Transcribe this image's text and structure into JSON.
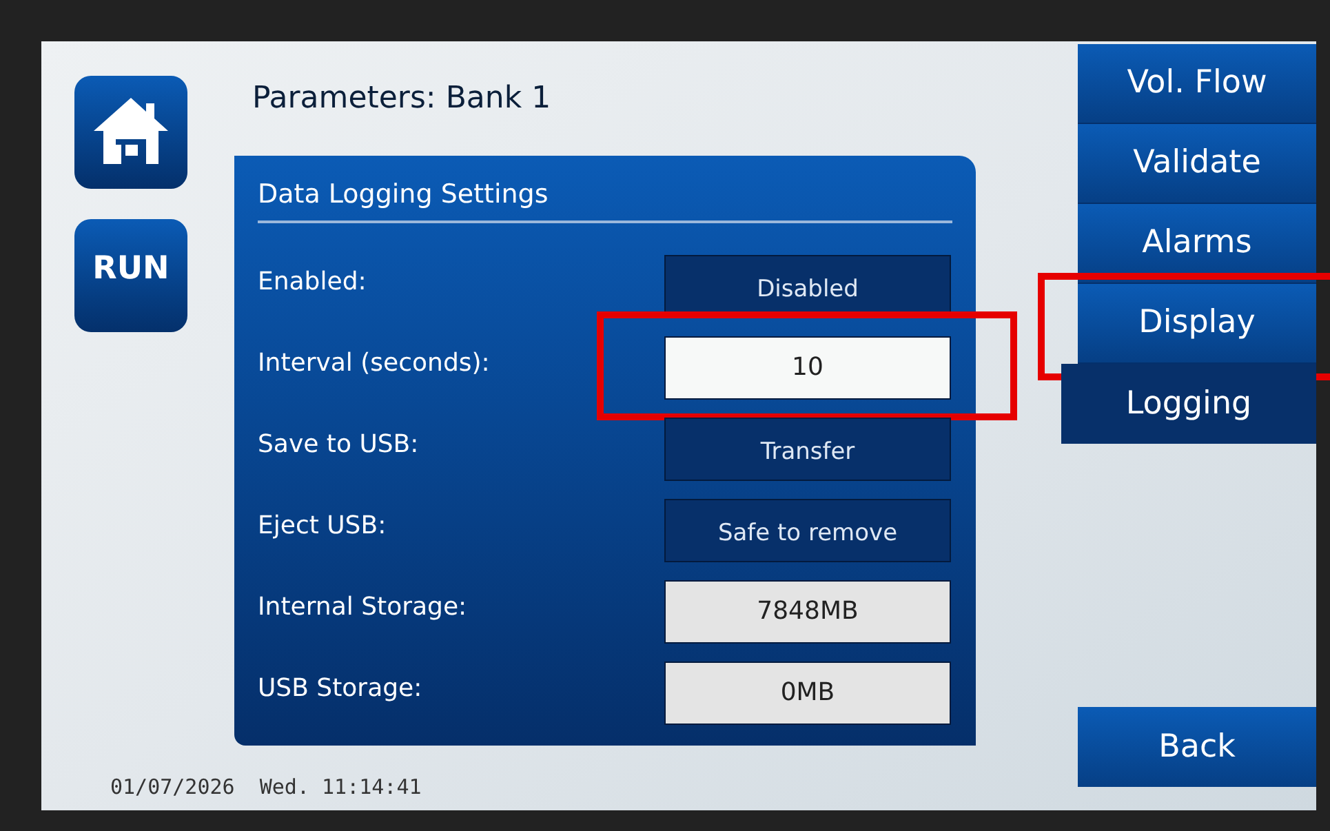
{
  "header": {
    "title": "Parameters: Bank 1"
  },
  "side_buttons": [
    {
      "kind": "home"
    },
    {
      "kind": "run",
      "label": "RUN"
    }
  ],
  "panel": {
    "title": "Data Logging Settings",
    "rows": [
      {
        "label": "Enabled:",
        "value": "Disabled",
        "kind": "button",
        "highlighted": false
      },
      {
        "label": "Interval (seconds):",
        "value": "10",
        "kind": "input",
        "highlighted": true
      },
      {
        "label": "Save to USB:",
        "value": "Transfer",
        "kind": "button",
        "highlighted": false
      },
      {
        "label": "Eject USB:",
        "value": "Safe to remove",
        "kind": "button",
        "highlighted": false
      },
      {
        "label": "Internal Storage:",
        "value": "7848MB",
        "kind": "readout",
        "highlighted": false
      },
      {
        "label": "USB Storage:",
        "value": "0MB",
        "kind": "readout",
        "highlighted": false
      }
    ]
  },
  "tabs": [
    {
      "label": "Vol. Flow",
      "selected": false,
      "highlighted": false
    },
    {
      "label": "Validate",
      "selected": false,
      "highlighted": false
    },
    {
      "label": "Alarms",
      "selected": false,
      "highlighted": false
    },
    {
      "label": "Display",
      "selected": false,
      "highlighted": true
    },
    {
      "label": "Logging",
      "selected": true,
      "highlighted": false
    }
  ],
  "back_button": {
    "label": "Back"
  },
  "status_bar": {
    "datetime": "01/07/2026  Wed. 11:14:41"
  }
}
